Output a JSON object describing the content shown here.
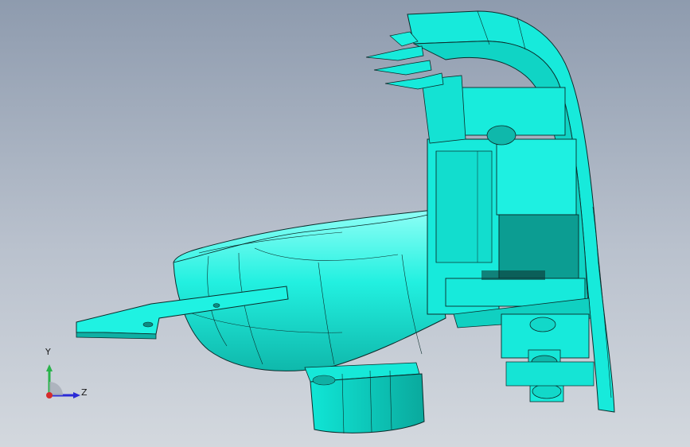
{
  "viewport": {
    "background_top": "#8e9bae",
    "background_bottom": "#d3d8de",
    "model_color": "#13e6d6",
    "model_shadow_color": "#0aa59a",
    "edge_color": "#0b2b2a"
  },
  "triad": {
    "y_label": "Y",
    "z_label": "Z",
    "y_axis_color": "#29b34a",
    "z_axis_color": "#2b2bd6",
    "origin_color": "#d62b2b"
  }
}
